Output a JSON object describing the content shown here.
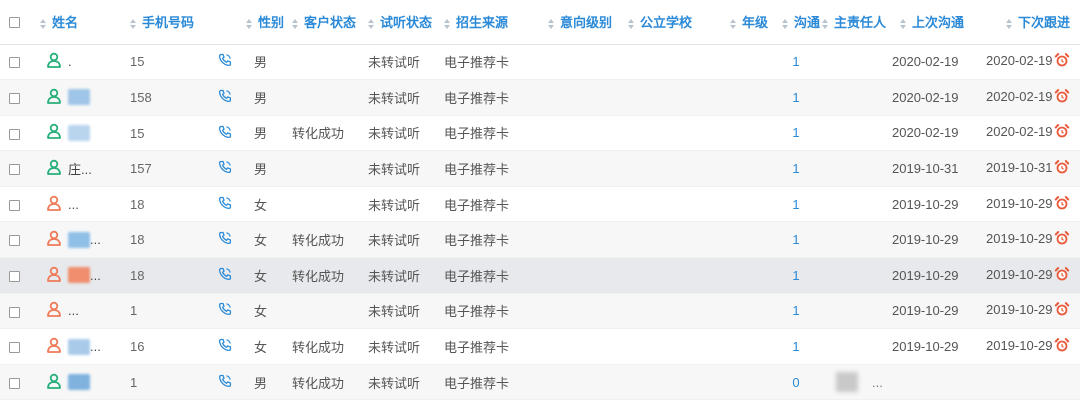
{
  "colors": {
    "header_text": "#2b8ad8",
    "male_icon": "#27b07a",
    "female_icon": "#f07b59",
    "alarm": "#e95b3c"
  },
  "columns": [
    {
      "key": "select",
      "label": ""
    },
    {
      "key": "name",
      "label": "姓名"
    },
    {
      "key": "phone",
      "label": "手机号码"
    },
    {
      "key": "gender",
      "label": "性别"
    },
    {
      "key": "status",
      "label": "客户状态"
    },
    {
      "key": "trial",
      "label": "试听状态"
    },
    {
      "key": "source",
      "label": "招生来源"
    },
    {
      "key": "intent",
      "label": "意向级别"
    },
    {
      "key": "school",
      "label": "公立学校"
    },
    {
      "key": "grade",
      "label": "年级"
    },
    {
      "key": "contact",
      "label": "沟通"
    },
    {
      "key": "owner",
      "label": "主责任人"
    },
    {
      "key": "last",
      "label": "上次沟通"
    },
    {
      "key": "next",
      "label": "下次跟进"
    }
  ],
  "rows": [
    {
      "gender_type": "male",
      "name": ".",
      "name_blur": false,
      "phone": "15",
      "gender": "男",
      "status": "",
      "trial": "未转试听",
      "source": "电子推荐卡",
      "contact": "1",
      "owner": "",
      "last": "2020-02-19",
      "next": "2020-02-19"
    },
    {
      "gender_type": "male",
      "name": "",
      "name_blur": true,
      "phone": "158",
      "gender": "男",
      "status": "",
      "trial": "未转试听",
      "source": "电子推荐卡",
      "contact": "1",
      "owner": "",
      "last": "2020-02-19",
      "next": "2020-02-19"
    },
    {
      "gender_type": "male",
      "name": "",
      "name_blur": true,
      "phone": "15",
      "gender": "男",
      "status": "转化成功",
      "trial": "未转试听",
      "source": "电子推荐卡",
      "contact": "1",
      "owner": "",
      "last": "2020-02-19",
      "next": "2020-02-19"
    },
    {
      "gender_type": "male",
      "name": "庄...",
      "name_blur": false,
      "phone": "157",
      "gender": "男",
      "status": "",
      "trial": "未转试听",
      "source": "电子推荐卡",
      "contact": "1",
      "owner": "",
      "last": "2019-10-31",
      "next": "2019-10-31"
    },
    {
      "gender_type": "female",
      "name": "...",
      "name_blur": false,
      "phone": "18",
      "gender": "女",
      "status": "",
      "trial": "未转试听",
      "source": "电子推荐卡",
      "contact": "1",
      "owner": "",
      "last": "2019-10-29",
      "next": "2019-10-29"
    },
    {
      "gender_type": "female",
      "name": "...",
      "name_blur": true,
      "phone": "18",
      "gender": "女",
      "status": "转化成功",
      "trial": "未转试听",
      "source": "电子推荐卡",
      "contact": "1",
      "owner": "",
      "last": "2019-10-29",
      "next": "2019-10-29"
    },
    {
      "gender_type": "female",
      "name": "...",
      "name_blur": true,
      "phone": "18",
      "gender": "女",
      "status": "转化成功",
      "trial": "未转试听",
      "source": "电子推荐卡",
      "contact": "1",
      "owner": "",
      "last": "2019-10-29",
      "next": "2019-10-29"
    },
    {
      "gender_type": "female",
      "name": "...",
      "name_blur": false,
      "phone": "1",
      "gender": "女",
      "status": "",
      "trial": "未转试听",
      "source": "电子推荐卡",
      "contact": "1",
      "owner": "",
      "last": "2019-10-29",
      "next": "2019-10-29"
    },
    {
      "gender_type": "female",
      "name": "...",
      "name_blur": true,
      "phone": "16",
      "gender": "女",
      "status": "转化成功",
      "trial": "未转试听",
      "source": "电子推荐卡",
      "contact": "1",
      "owner": "",
      "last": "2019-10-29",
      "next": "2019-10-29"
    },
    {
      "gender_type": "male",
      "name": "",
      "name_blur": true,
      "phone": "1",
      "gender": "男",
      "status": "转化成功",
      "trial": "未转试听",
      "source": "电子推荐卡",
      "contact": "0",
      "owner": "...",
      "last": "",
      "next": ""
    }
  ]
}
